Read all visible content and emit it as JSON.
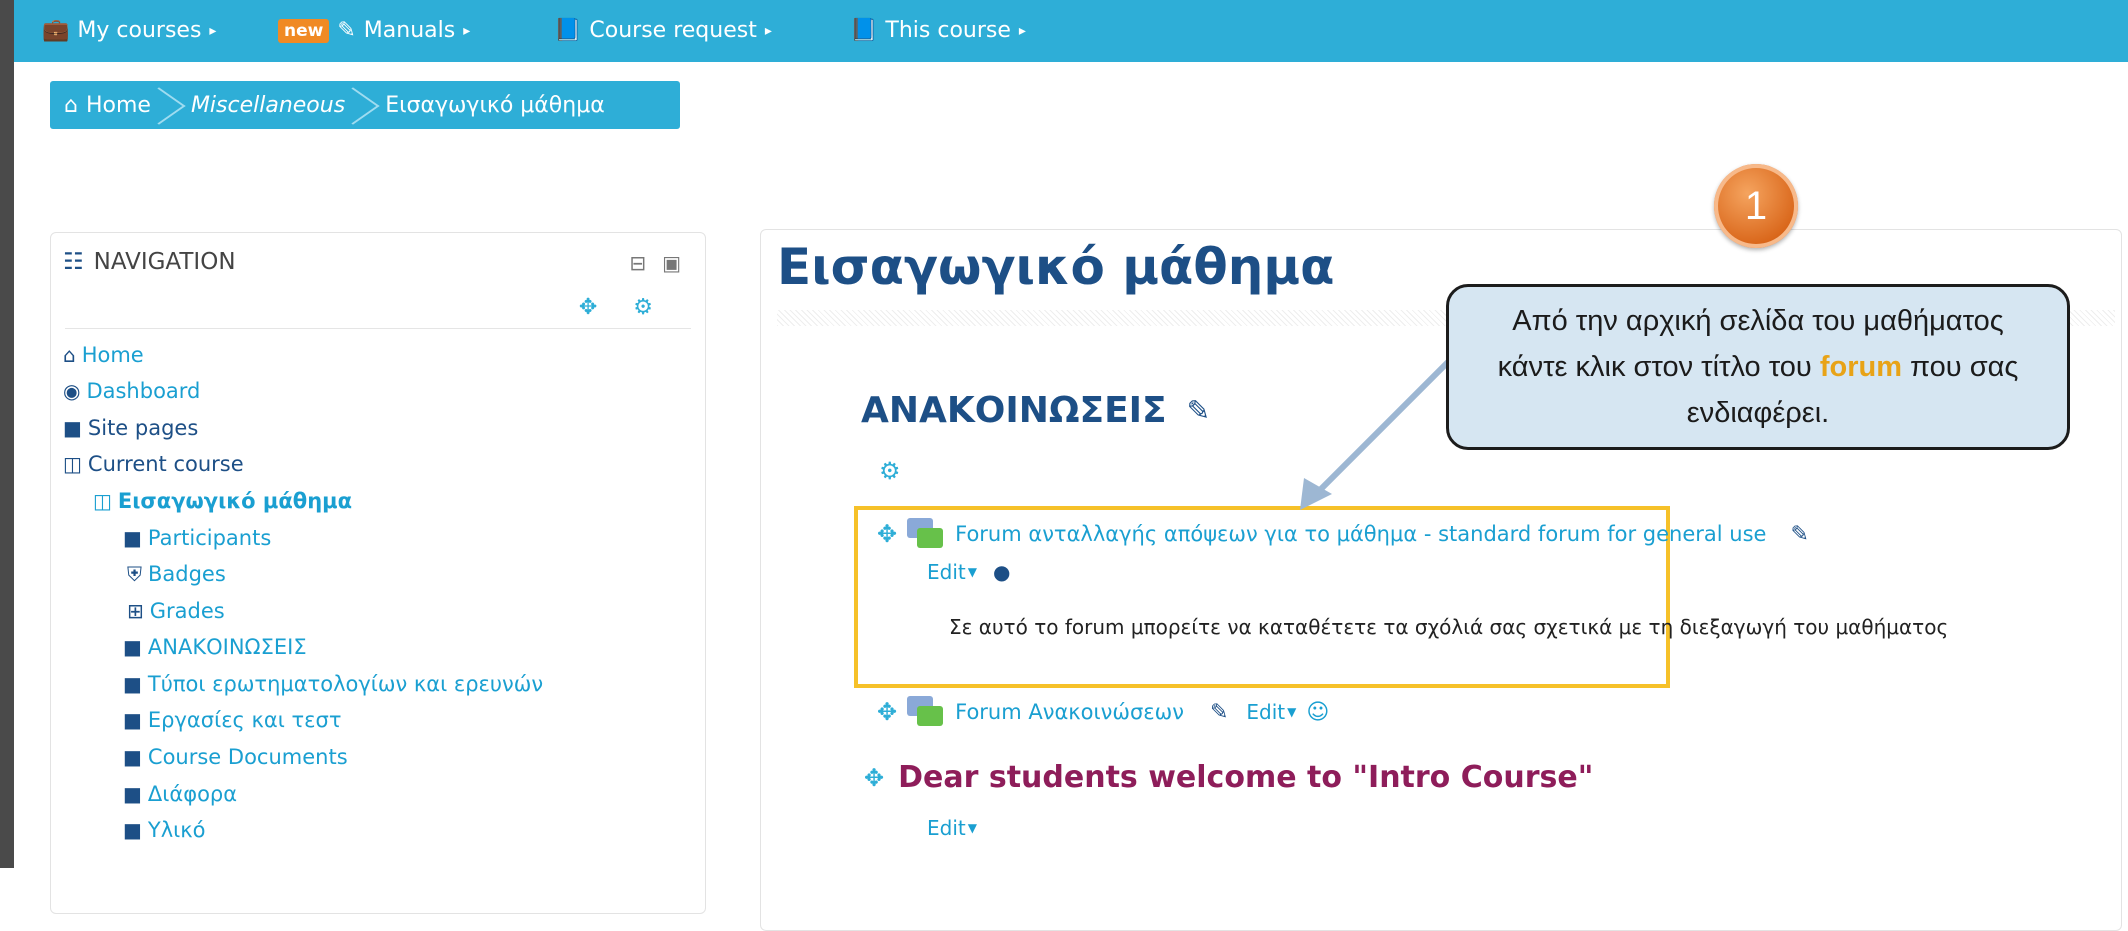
{
  "topnav": {
    "my_courses": "My courses",
    "new_badge": "new",
    "manuals": "Manuals",
    "course_request": "Course request",
    "this_course": "This course"
  },
  "breadcrumb": {
    "home": "Home",
    "category": "Miscellaneous",
    "course": "Εισαγωγικό μάθημα"
  },
  "navigation": {
    "title": "NAVIGATION",
    "items": {
      "home": "Home",
      "dashboard": "Dashboard",
      "site_pages": "Site pages",
      "current_course": "Current course",
      "course_name": "Εισαγωγικό μάθημα",
      "participants": "Participants",
      "badges": "Badges",
      "grades": "Grades",
      "announcements": "ΑΝΑΚΟΙΝΩΣΕΙΣ",
      "questionnaire_types": "Τύποι ερωτηματολογίων και ερευνών",
      "assignments": "Εργασίες και τεστ",
      "course_documents": "Course Documents",
      "misc": "Διάφορα",
      "material": "Υλικό"
    }
  },
  "main": {
    "page_title": "Εισαγωγικό μάθημα",
    "section_title": "ΑΝΑΚΟΙΝΩΣΕΙΣ",
    "forum1": "Forum ανταλλαγής απόψεων για το μάθημα - standard forum for general use",
    "edit": "Edit",
    "forum1_desc": "Σε αυτό το forum μπορείτε να καταθέτετε τα σχόλιά σας σχετικά με τη διεξαγωγή του μαθήματος",
    "forum2": "Forum Ανακοινώσεων",
    "welcome": "Dear students welcome to \"Intro Course\""
  },
  "callout": {
    "step_number": "1",
    "text_before": "Από την αρχική σελίδα του μαθήματος  κάντε κλικ στον τίτλο του ",
    "text_highlight": "forum",
    "text_after": " που σας ενδιαφέρει."
  },
  "colors": {
    "topbar": "#2eaed7",
    "link": "#1a9fd1",
    "heading": "#1d4f86",
    "highlight_box": "#f6c129",
    "welcome_text": "#8e1d5a"
  }
}
